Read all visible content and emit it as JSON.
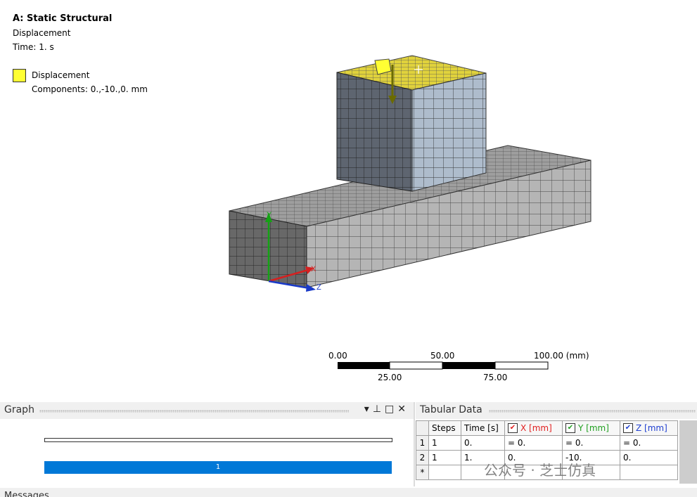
{
  "viewport": {
    "analysis_title": "A: Static Structural",
    "result_name": "Displacement",
    "time_label": "Time: 1. s",
    "legend_item": "Displacement",
    "legend_components": "Components: 0.,-10.,0. mm",
    "triad": {
      "x": "X",
      "y": "Y",
      "z": "Z"
    },
    "scale": {
      "top": [
        "0.00",
        "50.00",
        "100.00 (mm)"
      ],
      "bottom": [
        "25.00",
        "75.00"
      ]
    },
    "colors": {
      "load_highlight": "#ffff33",
      "block_face": "#aebccc",
      "base_face": "#b7b7b7",
      "base_side": "#6d6d6d"
    }
  },
  "graph_panel": {
    "title": "Graph",
    "icons": [
      "dropdown-icon",
      "pin-icon",
      "maximize-icon",
      "close-icon"
    ],
    "step_label": "1"
  },
  "tabular_panel": {
    "title": "Tabular Data",
    "columns": [
      "Steps",
      "Time [s]",
      "X [mm]",
      "Y [mm]",
      "Z [mm]"
    ],
    "column_colors": {
      "x": "#e02020",
      "y": "#20a020",
      "z": "#2040d0"
    },
    "rows": [
      {
        "index": "1",
        "steps": "1",
        "time": "0.",
        "x": "= 0.",
        "y": "= 0.",
        "z": "= 0."
      },
      {
        "index": "2",
        "steps": "1",
        "time": "1.",
        "x": "0.",
        "y": "-10.",
        "z": "0."
      }
    ],
    "new_row_marker": "*"
  },
  "messages_panel": {
    "title": "Messages"
  },
  "watermark": "公众号 · 芝士仿真"
}
